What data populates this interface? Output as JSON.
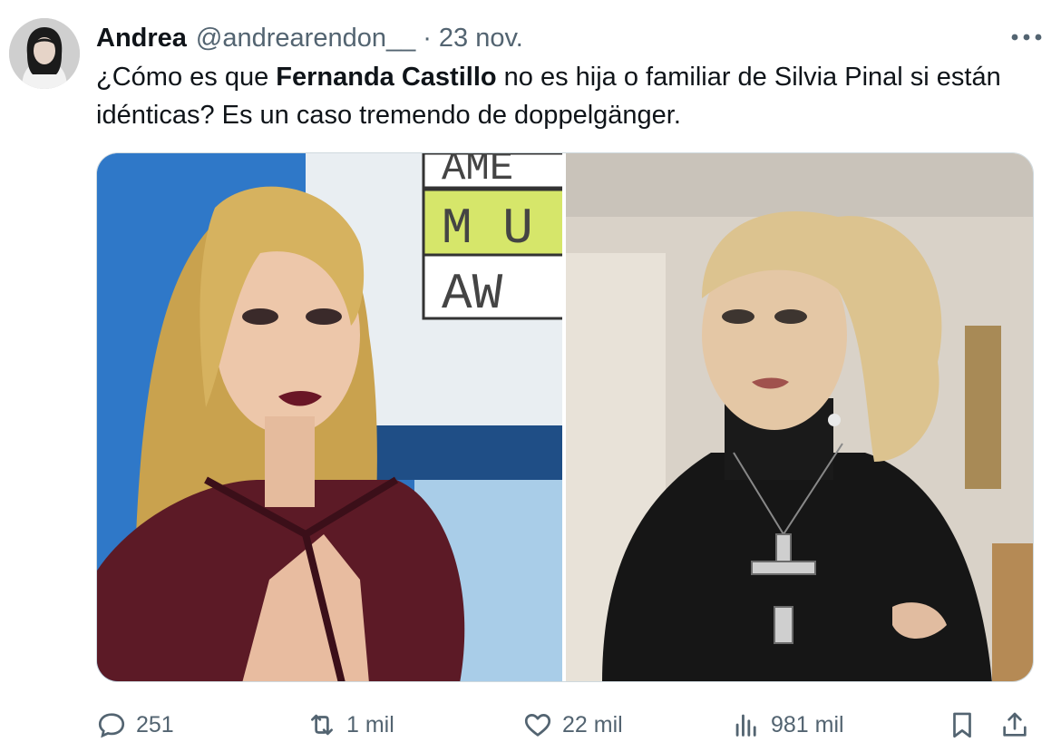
{
  "tweet": {
    "author_name": "Andrea",
    "handle": "@andrearendon__",
    "separator": "·",
    "date": "23 nov.",
    "text_before": "¿Cómo es que ",
    "text_bold": "Fernanda Castillo",
    "text_after": " no es hija o familiar de Silvia Pinal si están idénticas? Es un caso tremendo de doppelgänger."
  },
  "media_background": {
    "left_sign_lines": [
      "AME",
      "M U",
      "AW"
    ]
  },
  "actions": {
    "replies": "251",
    "reposts": "1 mil",
    "likes": "22 mil",
    "views": "981 mil"
  },
  "icons": {
    "more": "more-horizontal-icon",
    "reply": "reply-icon",
    "repost": "repost-icon",
    "like": "heart-icon",
    "views": "views-chart-icon",
    "bookmark": "bookmark-icon",
    "share": "share-icon"
  }
}
